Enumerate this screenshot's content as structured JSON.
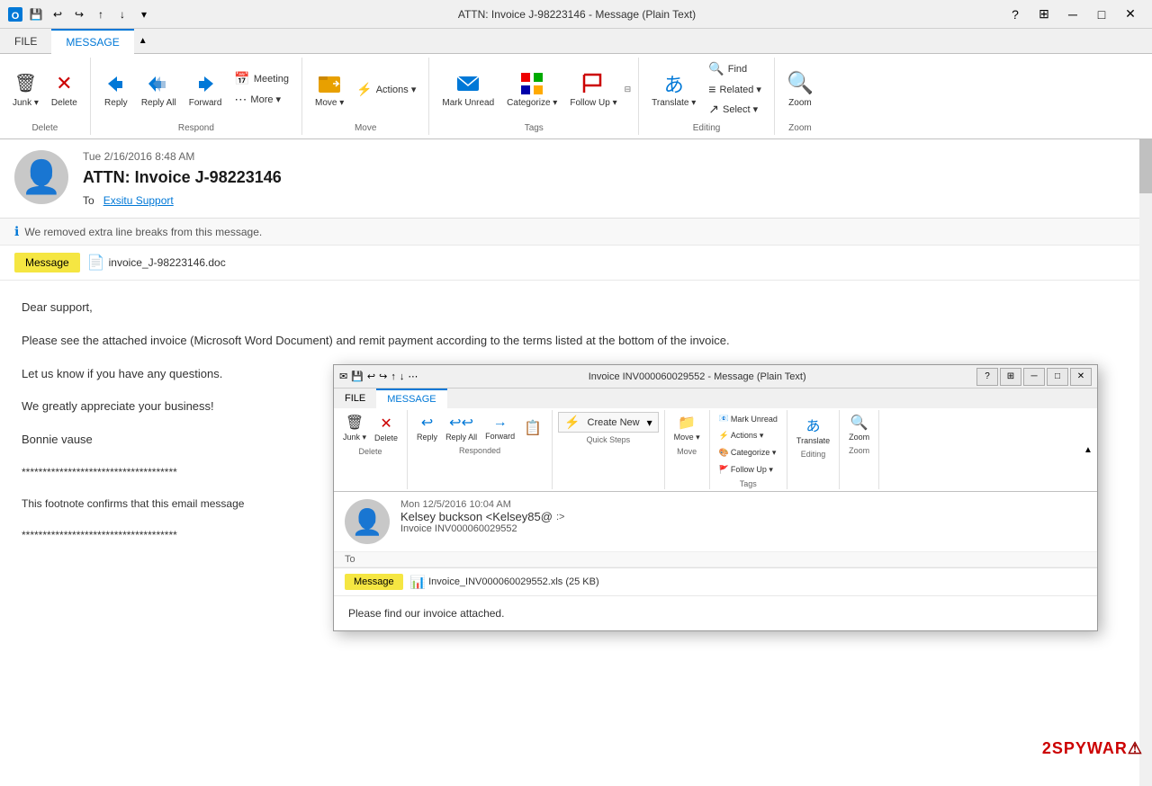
{
  "titleBar": {
    "title": "ATTN: Invoice J-98223146 - Message (Plain Text)",
    "helpBtn": "?",
    "minimizeBtn": "─",
    "restoreBtn": "□",
    "closeBtn": "✕"
  },
  "quickAccess": {
    "icons": [
      "💾",
      "↩",
      "↪",
      "↑",
      "↓",
      "▾"
    ]
  },
  "ribbon": {
    "tabs": [
      "FILE",
      "MESSAGE"
    ],
    "activeTab": "MESSAGE",
    "groups": [
      {
        "label": "Delete",
        "items": [
          {
            "type": "big",
            "icon": "🗑",
            "label": "Junk ▾"
          },
          {
            "type": "big",
            "icon": "✕",
            "label": "Delete"
          }
        ]
      },
      {
        "label": "Respond",
        "items": [
          {
            "type": "big",
            "icon": "↩",
            "label": "Reply"
          },
          {
            "type": "big",
            "icon": "↩↩",
            "label": "Reply All"
          },
          {
            "type": "big",
            "icon": "→",
            "label": "Forward"
          },
          {
            "type": "small-group",
            "items": [
              {
                "icon": "📅",
                "label": "Meeting"
              },
              {
                "icon": "⋯",
                "label": "More ▾"
              }
            ]
          }
        ]
      },
      {
        "label": "Move",
        "items": [
          {
            "type": "big",
            "icon": "📁",
            "label": "Move ▾"
          },
          {
            "type": "small-group",
            "items": [
              {
                "icon": "⚡",
                "label": "Actions ▾"
              }
            ]
          }
        ]
      },
      {
        "label": "Tags",
        "items": [
          {
            "type": "big",
            "icon": "🏷",
            "label": "Mark Unread"
          },
          {
            "type": "big",
            "icon": "🎨",
            "label": "Categorize ▾"
          },
          {
            "type": "big",
            "icon": "🚩",
            "label": "Follow Up ▾"
          }
        ]
      },
      {
        "label": "Editing",
        "items": [
          {
            "type": "big",
            "icon": "あ",
            "label": "Translate ▾"
          },
          {
            "type": "small-group",
            "items": [
              {
                "icon": "🔍",
                "label": "Find"
              },
              {
                "icon": "≡",
                "label": "Related ▾"
              },
              {
                "icon": "⬆",
                "label": "Select ▾"
              }
            ]
          }
        ]
      },
      {
        "label": "Zoom",
        "items": [
          {
            "type": "big",
            "icon": "🔍",
            "label": "Zoom"
          }
        ]
      }
    ]
  },
  "message": {
    "date": "Tue 2/16/2016 8:48 AM",
    "subject": "ATTN: Invoice J-98223146",
    "to": "Exsitu Support",
    "infoBar": "We removed extra line breaks from this message.",
    "attachments": [
      {
        "name": "invoice_J-98223146.doc",
        "type": "doc"
      }
    ],
    "body": {
      "greeting": "Dear support,",
      "para1": "Please see the attached invoice (Microsoft Word Document) and remit payment according to the terms listed at the bottom of the invoice.",
      "para2": "Let us know if you have any questions.",
      "para3": "We greatly appreciate your business!",
      "signature": "Bonnie vause",
      "footer1": "************************************",
      "footer2": "This footnote confirms that this email messag",
      "footer3": "************************************"
    }
  },
  "nestedEmail": {
    "title": "Invoice INV000060029552 - Message (Plain Text)",
    "tabs": [
      "FILE",
      "MESSAGE"
    ],
    "activeTab": "MESSAGE",
    "groups": [
      {
        "label": "Delete",
        "items": [
          "🗑 Junk ▾",
          "✕ Delete"
        ]
      },
      {
        "label": "Responded",
        "items": [
          "↩ Reply",
          "↩↩ Reply All",
          "→ Forward"
        ]
      },
      {
        "label": "Quick Steps",
        "items": [
          "Create New ▾"
        ]
      },
      {
        "label": "Move",
        "items": [
          "📁 Move"
        ]
      },
      {
        "label": "Tags",
        "items": [
          "Mark Unread",
          "Actions ▾",
          "Categorize ▾",
          "Follow Up ▾"
        ]
      },
      {
        "label": "Editing",
        "items": [
          "あ Translate ▾"
        ]
      },
      {
        "label": "Zoom",
        "items": [
          "🔍 Zoom"
        ]
      }
    ],
    "date": "Mon 12/5/2016 10:04 AM",
    "from": "Kelsey buckson <Kelsey85@",
    "fromArrow": ":>",
    "subject": "Invoice INV000060029552",
    "to": "",
    "attachment": "Invoice_INV000060029552.xls (25 KB)",
    "body": "Please find our invoice attached."
  },
  "watermark": "2SPYWAR"
}
